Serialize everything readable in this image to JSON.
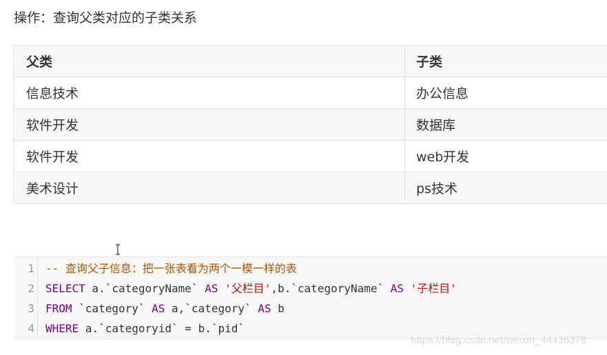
{
  "heading": "操作：查询父类对应的子类关系",
  "table": {
    "headers": [
      "父类",
      "子类"
    ],
    "rows": [
      [
        "信息技术",
        "办公信息"
      ],
      [
        "软件开发",
        "数据库"
      ],
      [
        "软件开发",
        "web开发"
      ],
      [
        "美术设计",
        "ps技术"
      ]
    ]
  },
  "code": {
    "line_numbers": [
      "1",
      "2",
      "3",
      "4"
    ],
    "lines": [
      [
        {
          "t": "comment",
          "v": "-- 查询父子信息：把一张表看为两个一模一样的表"
        }
      ],
      [
        {
          "t": "kw",
          "v": "SELECT"
        },
        {
          "t": "plain",
          "v": " a.`categoryName` "
        },
        {
          "t": "kw",
          "v": "AS"
        },
        {
          "t": "plain",
          "v": " "
        },
        {
          "t": "str",
          "v": "'父栏目'"
        },
        {
          "t": "plain",
          "v": ",b.`categoryName` "
        },
        {
          "t": "kw",
          "v": "AS"
        },
        {
          "t": "plain",
          "v": " "
        },
        {
          "t": "str",
          "v": "'子栏目'"
        }
      ],
      [
        {
          "t": "kw",
          "v": "FROM"
        },
        {
          "t": "plain",
          "v": " `category` "
        },
        {
          "t": "kw",
          "v": "AS"
        },
        {
          "t": "plain",
          "v": " a,`category` "
        },
        {
          "t": "kw",
          "v": "AS"
        },
        {
          "t": "plain",
          "v": " b"
        }
      ],
      [
        {
          "t": "kw",
          "v": "WHERE"
        },
        {
          "t": "plain",
          "v": " a.`categoryid` = b.`pid`"
        }
      ]
    ]
  },
  "watermark": "https://blog.csdn.net/weixin_44436378",
  "colors": {
    "comment": "#aa5500",
    "keyword": "#770088",
    "string": "#aa1111",
    "table_border": "#dfe2e5"
  }
}
